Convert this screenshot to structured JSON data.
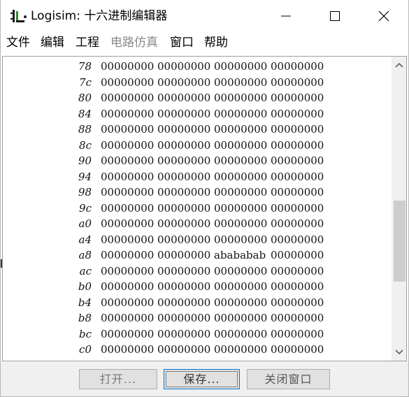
{
  "window": {
    "title": "Logisim: 十六进制编辑器"
  },
  "menu": {
    "items": [
      {
        "label": "文件",
        "enabled": true
      },
      {
        "label": "编辑",
        "enabled": true
      },
      {
        "label": "工程",
        "enabled": true
      },
      {
        "label": "电路仿真",
        "enabled": false
      },
      {
        "label": "窗口",
        "enabled": true
      },
      {
        "label": "帮助",
        "enabled": true
      }
    ]
  },
  "hex": {
    "rows": [
      {
        "addr": "78",
        "cells": [
          "00000000",
          "00000000",
          "00000000",
          "00000000"
        ]
      },
      {
        "addr": "7c",
        "cells": [
          "00000000",
          "00000000",
          "00000000",
          "00000000"
        ]
      },
      {
        "addr": "80",
        "cells": [
          "00000000",
          "00000000",
          "00000000",
          "00000000"
        ]
      },
      {
        "addr": "84",
        "cells": [
          "00000000",
          "00000000",
          "00000000",
          "00000000"
        ]
      },
      {
        "addr": "88",
        "cells": [
          "00000000",
          "00000000",
          "00000000",
          "00000000"
        ]
      },
      {
        "addr": "8c",
        "cells": [
          "00000000",
          "00000000",
          "00000000",
          "00000000"
        ]
      },
      {
        "addr": "90",
        "cells": [
          "00000000",
          "00000000",
          "00000000",
          "00000000"
        ]
      },
      {
        "addr": "94",
        "cells": [
          "00000000",
          "00000000",
          "00000000",
          "00000000"
        ]
      },
      {
        "addr": "98",
        "cells": [
          "00000000",
          "00000000",
          "00000000",
          "00000000"
        ]
      },
      {
        "addr": "9c",
        "cells": [
          "00000000",
          "00000000",
          "00000000",
          "00000000"
        ]
      },
      {
        "addr": "a0",
        "cells": [
          "00000000",
          "00000000",
          "00000000",
          "00000000"
        ]
      },
      {
        "addr": "a4",
        "cells": [
          "00000000",
          "00000000",
          "00000000",
          "00000000"
        ]
      },
      {
        "addr": "a8",
        "cells": [
          "00000000",
          "00000000",
          "abababab",
          "00000000"
        ]
      },
      {
        "addr": "ac",
        "cells": [
          "00000000",
          "00000000",
          "00000000",
          "00000000"
        ]
      },
      {
        "addr": "b0",
        "cells": [
          "00000000",
          "00000000",
          "00000000",
          "00000000"
        ]
      },
      {
        "addr": "b4",
        "cells": [
          "00000000",
          "00000000",
          "00000000",
          "00000000"
        ]
      },
      {
        "addr": "b8",
        "cells": [
          "00000000",
          "00000000",
          "00000000",
          "00000000"
        ]
      },
      {
        "addr": "bc",
        "cells": [
          "00000000",
          "00000000",
          "00000000",
          "00000000"
        ]
      },
      {
        "addr": "c0",
        "cells": [
          "00000000",
          "00000000",
          "00000000",
          "00000000"
        ]
      }
    ]
  },
  "buttons": {
    "open": "打开...",
    "save": "保存...",
    "close": "关闭窗口"
  },
  "colors": {
    "focus_border": "#0078d7",
    "disabled_text": "#8a8a8a"
  }
}
